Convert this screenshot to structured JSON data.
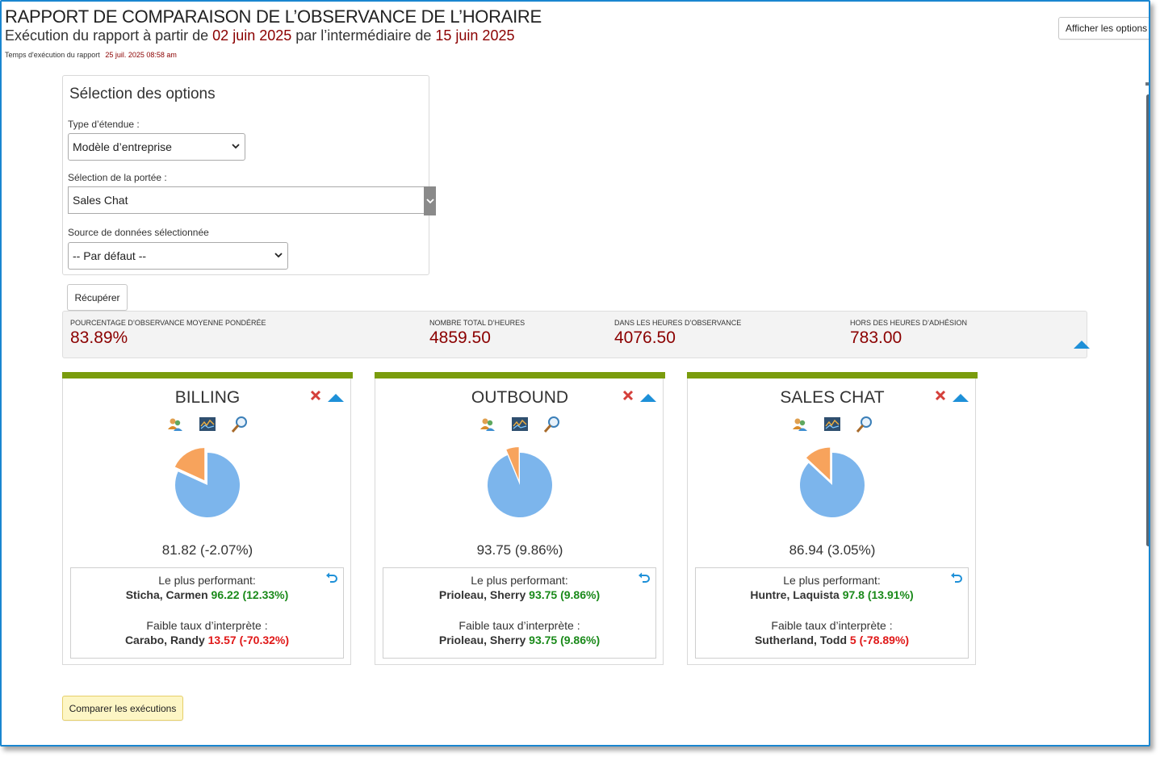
{
  "header": {
    "title": "RAPPORT DE COMPARAISON DE L’OBSERVANCE DE L’HORAIRE",
    "subtitle_prefix": "Exécution du rapport à partir de",
    "start_date": "02 juin 2025",
    "subtitle_mid": "par l’intermédiaire de",
    "end_date": "15 juin 2025",
    "runtime_label": "Temps d'exécution du rapport",
    "runtime_value": "25 juil. 2025 08:58 am",
    "show_options_label": "Afficher les options"
  },
  "options": {
    "title": "Sélection des options",
    "scope_type_label": "Type d’étendue :",
    "scope_type_value": "Modèle d’entreprise",
    "scope_selection_label": "Sélection de la portée :",
    "scope_selection_value": "Sales Chat",
    "data_source_label": "Source de données sélectionnée",
    "data_source_value": "-- Par défaut --",
    "fetch_label": "Récupérer"
  },
  "summary": {
    "stats": [
      {
        "label": "POURCENTAGE D’OBSERVANCE MOYENNE PONDÉRÉE",
        "value": "83.89%"
      },
      {
        "label": "NOMBRE TOTAL D’HEURES",
        "value": "4859.50"
      },
      {
        "label": "DANS LES HEURES D’OBSERVANCE",
        "value": "4076.50"
      },
      {
        "label": "HORS DES HEURES D’ADHÉSION",
        "value": "783.00"
      }
    ]
  },
  "cards": [
    {
      "name": "BILLING",
      "adherence_pct": 81.82,
      "score": "81.82 (-2.07%)",
      "top_label": "Le plus performant:",
      "top_name": "Sticha, Carmen",
      "top_value": "96.22 (12.33%)",
      "low_label": "Faible taux d’interprète :",
      "low_name": "Carabo, Randy",
      "low_value": "13.57 (-70.32%)",
      "low_status": "bad"
    },
    {
      "name": "OUTBOUND",
      "adherence_pct": 93.75,
      "score": "93.75 (9.86%)",
      "top_label": "Le plus performant:",
      "top_name": "Prioleau, Sherry",
      "top_value": "93.75 (9.86%)",
      "low_label": "Faible taux d’interprète :",
      "low_name": "Prioleau, Sherry",
      "low_value": "93.75 (9.86%)",
      "low_status": "good"
    },
    {
      "name": "SALES CHAT",
      "adherence_pct": 86.94,
      "score": "86.94 (3.05%)",
      "top_label": "Le plus performant:",
      "top_name": "Huntre, Laquista",
      "top_value": "97.8 (13.91%)",
      "low_label": "Faible taux d’interprète :",
      "low_name": "Sutherland, Todd",
      "low_value": "5 (-78.89%)",
      "low_status": "bad"
    }
  ],
  "compare_label": "Comparer les exécutions",
  "colors": {
    "accent_bar": "#7a9c0d",
    "pie_main": "#7cb5ec",
    "pie_slice": "#f7a35c",
    "value_red": "#8b0000",
    "good": "#1a8a1a",
    "bad": "#e01818"
  },
  "icons": [
    "agents-icon",
    "trend-chart-icon",
    "magnify-icon",
    "close-icon",
    "collapse-up-icon",
    "undo-icon"
  ]
}
